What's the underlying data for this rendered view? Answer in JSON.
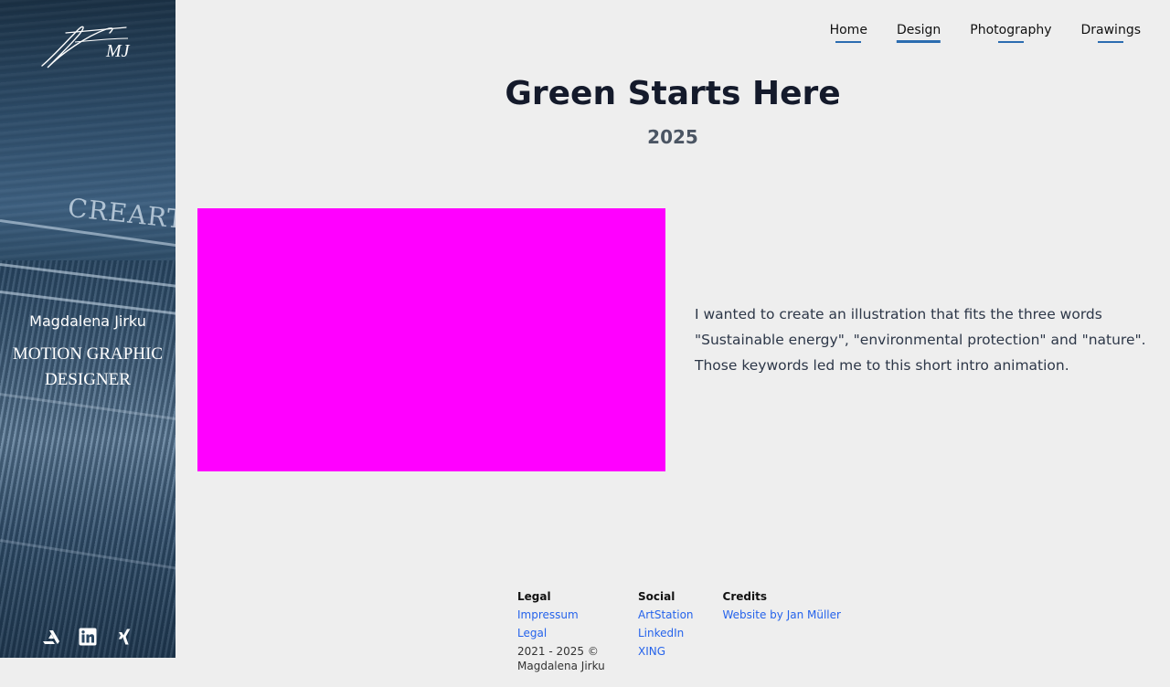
{
  "sidebar": {
    "logo_text": "MJ",
    "brand_engraving": "CREARTI",
    "name": "Magdalena Jirku",
    "role_line1": "MOTION GRAPHIC",
    "role_line2": "DESIGNER",
    "social_icons": [
      "artstation-icon",
      "linkedin-icon",
      "xing-icon"
    ]
  },
  "nav": {
    "items": [
      {
        "label": "Home",
        "active": false
      },
      {
        "label": "Design",
        "active": true
      },
      {
        "label": "Photography",
        "active": false
      },
      {
        "label": "Drawings",
        "active": false
      }
    ]
  },
  "main": {
    "title": "Green Starts Here",
    "year": "2025",
    "media_color": "#ff00ff",
    "description": [
      "I wanted to create an illustration that fits the three words",
      "\"Sustainable energy\", \"environmental protection\" and \"nature\".",
      "Those keywords led me to this short intro animation."
    ]
  },
  "footer": {
    "legal": {
      "heading": "Legal",
      "links": [
        "Impressum",
        "Legal"
      ],
      "copyright_line1": "2021 - 2025 ©",
      "copyright_line2": "Magdalena Jirku"
    },
    "social": {
      "heading": "Social",
      "links": [
        "ArtStation",
        "LinkedIn",
        "XING"
      ]
    },
    "credits": {
      "heading": "Credits",
      "links": [
        "Website by Jan Müller"
      ]
    }
  },
  "colors": {
    "accent": "#2b6cb0",
    "link": "#2563eb",
    "background": "#eeeeee"
  }
}
